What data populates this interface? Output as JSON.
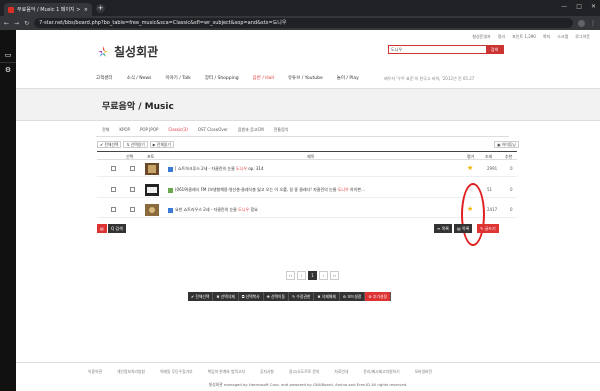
{
  "browser": {
    "tab_title": "무료음악 / Music 1 페이지 > 칠",
    "new_tab": "+",
    "url": "7-star.net/bbs/board.php?bo_table=free_music&sca=Classic&sfl=wr_subject&sop=and&stx=도니우",
    "win_controls": [
      "—",
      "□",
      "✕"
    ]
  },
  "sidebar": {
    "icons": [
      "monitor-icon",
      "gear-icon"
    ]
  },
  "site": {
    "top_links": [
      "칠성운영자",
      "정리",
      "포인트 1,290",
      "쪽지",
      "스크랩",
      "로그아웃"
    ],
    "logo": "칠성회관",
    "search_value": "도니우",
    "search_button": "검색",
    "nav": [
      "고객센터",
      "소식 / News",
      "이야기 / Talk",
      "장터 / Shopping",
      "음반 / Hall",
      "유튜브 / Youtube",
      "놀이 / Play"
    ],
    "nav_active": 4,
    "notice": "배우자 '우주 표준'의 한국고 써력, '2012년 전    05.27"
  },
  "board": {
    "title": "무료음악 / Music",
    "categories": [
      "전체",
      "KPOP",
      "POP JPOP",
      "Classic(3)",
      "OST CloseOver",
      "음원과 음고CM",
      "전통음악"
    ],
    "selected_category": 3,
    "tools": [
      "✔ 전체선택",
      "⇅ 선택읽기",
      "▶ 전체읽기"
    ],
    "rss": "▣ 아이튜닝",
    "headers": {
      "sel": "선택",
      "thumb": "포토",
      "subject": "제목",
      "rec": "평가",
      "hits": "조회",
      "votes": "추천"
    },
    "rows": [
      {
        "pre": "[ 쇼트하크루스 2세 - 자클린의 눈물  ",
        "kw": "도니우",
        "post": " op. 314",
        "hits": "2991",
        "votes": "0",
        "star": "★"
      },
      {
        "pre": "(0619)클래식 FM (보낼형해용·영산총·클레식총 잃고 오는 이 오를, 걸 좋 클래식! 자클린의 눈물  ",
        "kw": "도니우",
        "post": " 하이쁜...",
        "hits": "51",
        "votes": "0",
        "star": "☆"
      },
      {
        "pre": "요한 쇼트라우스 2세 - 자클린의 눈물  ",
        "kw": "도니우",
        "post": " 함요",
        "hits": "2417",
        "votes": "0",
        "star": "★"
      }
    ],
    "rss_btn": "▤",
    "search_btn": "Q 검색",
    "list_btn": "≡ 목록",
    "list2_btn": "▤ 목록",
    "write_btn": "✎ 글쓰기",
    "pager": [
      "‹‹",
      "‹",
      "1",
      "›",
      "››"
    ],
    "pager_current": 2,
    "actions": [
      "✔ 전체선택",
      "✖ 선택삭제",
      "⧉ 선택복사",
      "✥ 선택이동",
      "✎ 수정권한",
      "✖ 삭제해제",
      "⚙ 보드설정",
      "⚙ 추가설정"
    ]
  },
  "footer": {
    "links": [
      "이용약관",
      "개인정보처리방침",
      "이메일 무단수집거부",
      "책임의 한계와 법적고지",
      "공지사항",
      "광고/오도르로 문의",
      "자료안내",
      "윤리/메시제고지원하기",
      "모바일버전"
    ],
    "copyright": "칠성회관 managed by Harmosoft Corp. and powered by GNUBoard, Amina and Eres.ID All rights reserved."
  },
  "colors": {
    "accent": "#d33333",
    "star": "#f0b400",
    "annotation": "#e02020"
  }
}
